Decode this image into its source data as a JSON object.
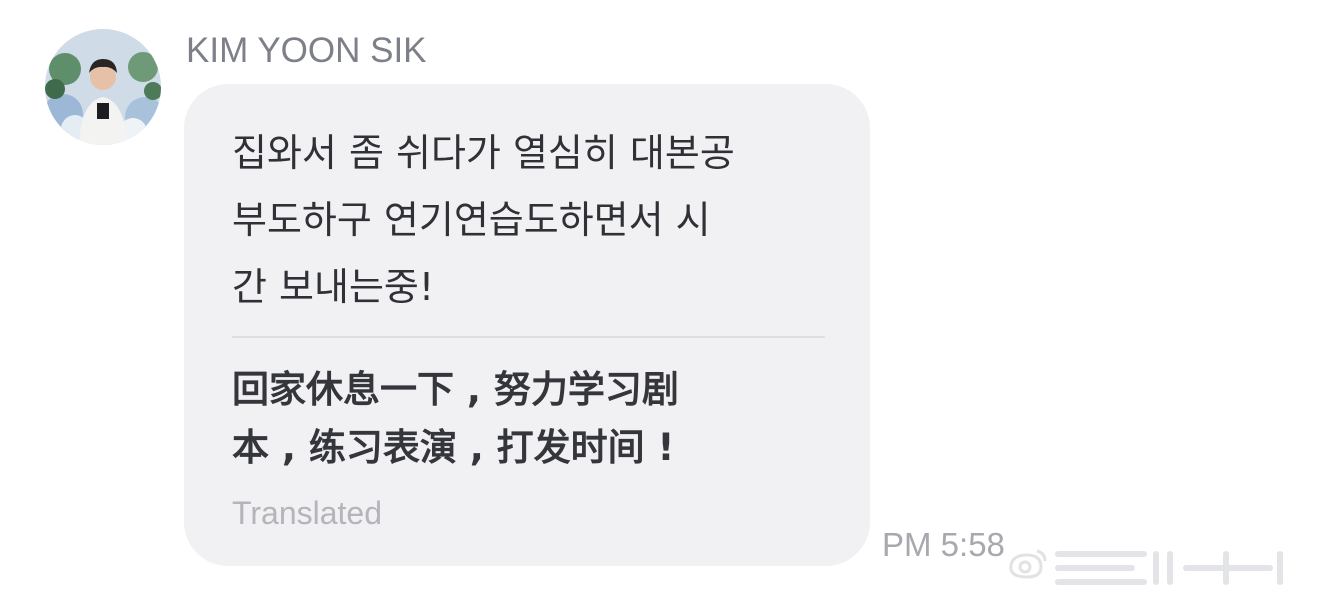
{
  "message": {
    "sender_name": "KIM YOON SIK",
    "original_text": "집와서 좀 쉬다가 열심히 대본공\n부도하구 연기연습도하면서 시\n간 보내는중!",
    "translated_text": "回家休息一下 , 努力学习剧\n本 , 练习表演 , 打发时间 !",
    "translated_label": "Translated",
    "timestamp": "PM 5:58"
  },
  "colors": {
    "bubble_background": "#f1f1f4",
    "sender_name": "#7d8088",
    "timestamp": "#a7a9ae"
  },
  "icons": {
    "avatar": "profile-photo",
    "watermark": "weibo-watermark"
  }
}
